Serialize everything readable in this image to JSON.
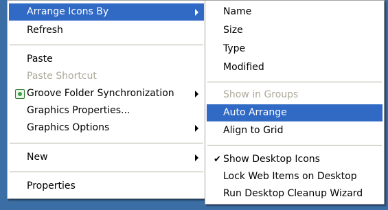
{
  "desktop_menu": {
    "arrange_icons_by": "Arrange Icons By",
    "refresh": "Refresh",
    "paste": "Paste",
    "paste_shortcut": "Paste Shortcut",
    "groove_folder_sync": "Groove Folder Synchronization",
    "graphics_properties": "Graphics Properties...",
    "graphics_options": "Graphics Options",
    "new": "New",
    "properties": "Properties",
    "groove_icon": "groove-icon"
  },
  "arrange_submenu": {
    "name": "Name",
    "size": "Size",
    "type": "Type",
    "modified": "Modified",
    "show_in_groups": "Show in Groups",
    "auto_arrange": "Auto Arrange",
    "align_to_grid": "Align to Grid",
    "show_desktop_icons": "Show Desktop Icons",
    "show_desktop_icons_checked": true,
    "lock_web_items": "Lock Web Items on Desktop",
    "run_cleanup_wizard": "Run Desktop Cleanup Wizard"
  },
  "colors": {
    "highlight": "#316ac5",
    "disabled_text": "#aca899",
    "menu_bg": "#ffffff"
  }
}
